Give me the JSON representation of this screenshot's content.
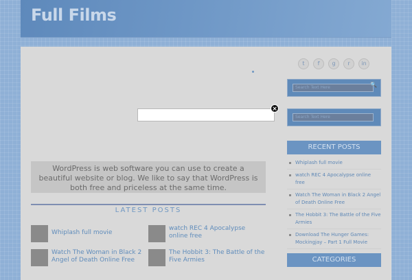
{
  "site": {
    "title": "Full Films"
  },
  "intro": {
    "text": "WordPress is web software you can use to create a beautiful website or blog. We like to say that WordPress is both free and priceless at the same time."
  },
  "latest_posts": {
    "heading": "LATEST POSTS",
    "items": [
      {
        "title": "Whiplash full movie"
      },
      {
        "title": "watch REC 4 Apocalypse online free"
      },
      {
        "title": "Watch The Woman in Black 2 Angel of Death Online Free"
      },
      {
        "title": "The Hobbit 3: The Battle of the Five Armies"
      }
    ]
  },
  "social": {
    "icons": [
      "twitter-icon",
      "facebook-icon",
      "google-plus-icon",
      "rss-icon",
      "linkedin-icon"
    ]
  },
  "search": {
    "placeholder": "Search Text Here"
  },
  "sidebar": {
    "recent_heading": "RECENT POSTS",
    "recent": [
      "Whiplash full movie",
      "watch REC 4 Apocalypse online free",
      "Watch The Woman in Black 2 Angel of Death Online Free",
      "The Hobbit 3: The Battle of the Five Armies",
      "Download The Hunger Games: Mockingjay – Part 1 Full Movie"
    ],
    "categories_heading": "CATEGORIES"
  },
  "popup": {
    "close_symbol": "×"
  },
  "colors": {
    "accent": "#6b94c2",
    "link": "#5f8cbb",
    "background": "#8fb0d6"
  }
}
